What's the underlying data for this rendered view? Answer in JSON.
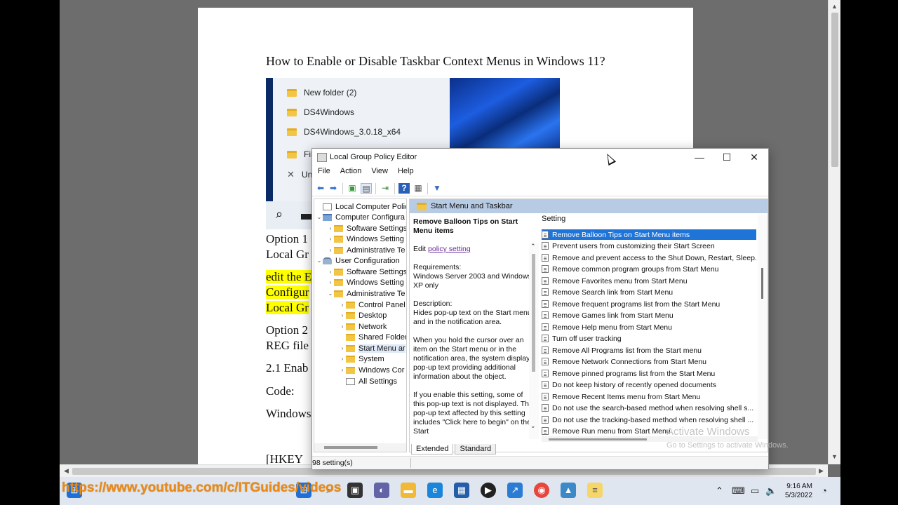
{
  "document": {
    "title": "How to Enable or Disable Taskbar Context Menus in Windows 11?",
    "lines": [
      {
        "text": "Option 1",
        "highlight": false
      },
      {
        "text": "Local Gr",
        "highlight": false
      },
      {
        "text": "edit the E",
        "highlight": true
      },
      {
        "text": "Configur",
        "highlight": true
      },
      {
        "text": "Local Gr",
        "highlight": true
      },
      {
        "text": "Option 2",
        "highlight": false
      },
      {
        "text": "REG file",
        "highlight": false
      },
      {
        "text": "2.1 Enab",
        "highlight": false
      },
      {
        "text": "Code:",
        "highlight": false
      },
      {
        "text": "Windows",
        "highlight": false
      },
      {
        "text": "[HKEY",
        "highlight": false
      }
    ]
  },
  "embedded_screenshot": {
    "folders": [
      "New folder (2)",
      "DS4Windows",
      "DS4Windows_3.0.18_x64"
    ],
    "menu_items": [
      "File",
      "Unp"
    ]
  },
  "gpe": {
    "title": "Local Group Policy Editor",
    "window_controls": {
      "minimize": "—",
      "maximize": "☐",
      "close": "✕"
    },
    "menu": [
      "File",
      "Action",
      "View",
      "Help"
    ],
    "tree": [
      {
        "label": "Local Computer Policy",
        "level": 0,
        "arrow": "",
        "icon": "doc"
      },
      {
        "label": "Computer Configura",
        "level": 0,
        "arrow": "⌄",
        "icon": "pc"
      },
      {
        "label": "Software Settings",
        "level": 1,
        "arrow": "›",
        "icon": "folder"
      },
      {
        "label": "Windows Setting",
        "level": 1,
        "arrow": "›",
        "icon": "folder"
      },
      {
        "label": "Administrative Te",
        "level": 1,
        "arrow": "›",
        "icon": "folder"
      },
      {
        "label": "User Configuration",
        "level": 0,
        "arrow": "⌄",
        "icon": "user"
      },
      {
        "label": "Software Settings",
        "level": 1,
        "arrow": "›",
        "icon": "folder"
      },
      {
        "label": "Windows Setting",
        "level": 1,
        "arrow": "›",
        "icon": "folder"
      },
      {
        "label": "Administrative Te",
        "level": 1,
        "arrow": "⌄",
        "icon": "folder"
      },
      {
        "label": "Control Panel",
        "level": 2,
        "arrow": "›",
        "icon": "folder"
      },
      {
        "label": "Desktop",
        "level": 2,
        "arrow": "›",
        "icon": "folder"
      },
      {
        "label": "Network",
        "level": 2,
        "arrow": "›",
        "icon": "folder"
      },
      {
        "label": "Shared Folder",
        "level": 2,
        "arrow": "",
        "icon": "folder"
      },
      {
        "label": "Start Menu ar",
        "level": 2,
        "arrow": "›",
        "icon": "folder",
        "selected": true
      },
      {
        "label": "System",
        "level": 2,
        "arrow": "›",
        "icon": "folder"
      },
      {
        "label": "Windows Cor",
        "level": 2,
        "arrow": "›",
        "icon": "folder"
      },
      {
        "label": "All Settings",
        "level": 2,
        "arrow": "",
        "icon": "doc"
      }
    ],
    "folder_header": "Start Menu and Taskbar",
    "description": {
      "heading": "Remove Balloon Tips on Start Menu items",
      "edit_prefix": "Edit",
      "edit_link": "policy setting",
      "requirements_label": "Requirements:",
      "requirements": "Windows Server 2003 and Windows XP only",
      "description_label": "Description:",
      "p1": "Hides pop-up text on the Start menu and in the notification area.",
      "p2": "When you hold the cursor over an item on the Start menu or in the notification area, the system displays pop-up text providing additional information about the object.",
      "p3": "If you enable this setting, some of this pop-up text is not displayed. The pop-up text affected by this setting includes \"Click here to begin\" on the Start"
    },
    "setting_column": "Setting",
    "settings": [
      "Remove Balloon Tips on Start Menu items",
      "Prevent users from customizing their Start Screen",
      "Remove and prevent access to the Shut Down, Restart, Sleep...",
      "Remove common program groups from Start Menu",
      "Remove Favorites menu from Start Menu",
      "Remove Search link from Start Menu",
      "Remove frequent programs list from the Start Menu",
      "Remove Games link from Start Menu",
      "Remove Help menu from Start Menu",
      "Turn off user tracking",
      "Remove All Programs list from the Start menu",
      "Remove Network Connections from Start Menu",
      "Remove pinned programs list from the Start Menu",
      "Do not keep history of recently opened documents",
      "Remove Recent Items menu from Start Menu",
      "Do not use the search-based method when resolving shell s...",
      "Do not use the tracking-based method when resolving shell ...",
      "Remove Run menu from Start Menu"
    ],
    "selected_setting_index": 0,
    "tabs": [
      "Extended",
      "Standard"
    ],
    "status": "98 setting(s)"
  },
  "watermark": {
    "line1": "Activate Windows",
    "line2": "Go to Settings to activate Windows."
  },
  "taskbar": {
    "overlay_url": "https://www.youtube.com/c/ITGuides/videos",
    "time": "9:16 AM",
    "date": "5/3/2022",
    "icons": [
      "windows-start-icon",
      "search-icon",
      "file-explorer-icon",
      "teams-chat-icon",
      "folder-icon",
      "edge-icon",
      "store-icon",
      "media-player-icon",
      "app-icon",
      "chrome-icon",
      "photos-icon",
      "notepad-icon"
    ],
    "colors": {
      "url": "#e98a1a",
      "selection": "#1f74d8"
    }
  }
}
